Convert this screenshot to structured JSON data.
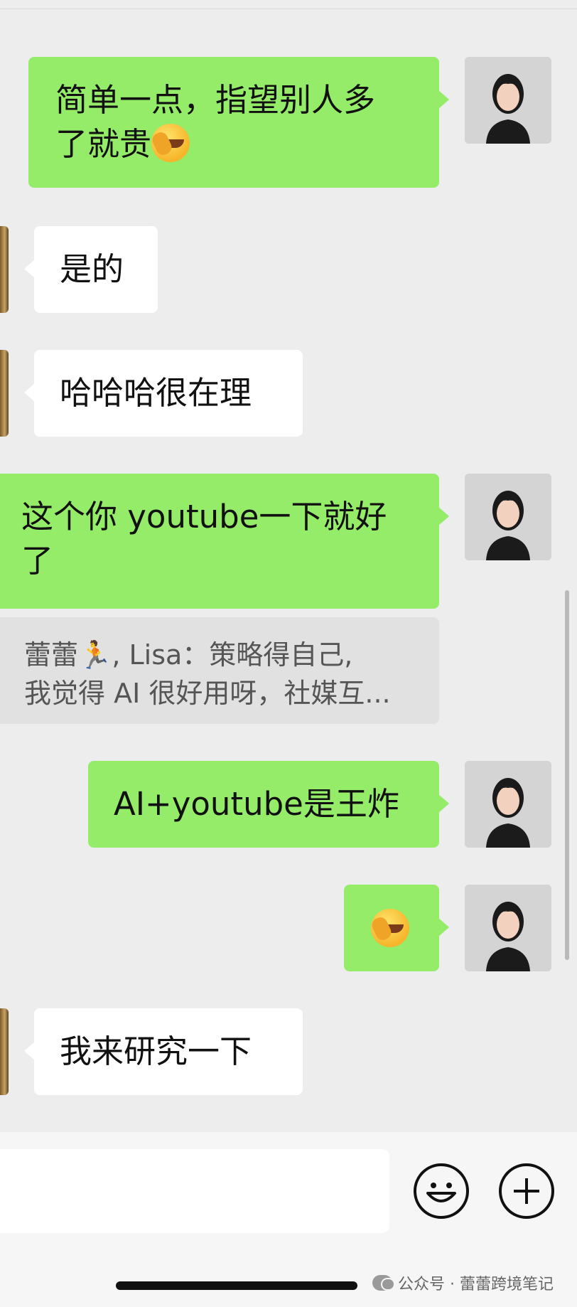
{
  "messages": [
    {
      "side": "me",
      "text": "简单一点，指望别人多了就贵",
      "line1": "简单一点，指望别人多",
      "line2": "了就贵",
      "emoji": "face-palm-emoji"
    },
    {
      "side": "them",
      "text": "是的"
    },
    {
      "side": "them",
      "text": "哈哈哈很在理"
    },
    {
      "side": "me",
      "line1": "这个你 youtube一下就好",
      "line2": "了"
    },
    {
      "side": "me",
      "text": "AI+youtube是王炸"
    },
    {
      "side": "me",
      "emoji": "face-palm-emoji"
    },
    {
      "side": "them",
      "text": "我来研究一下"
    }
  ],
  "quote": {
    "line1": "蕾蕾🏃, Lisa：策略得自己,",
    "line2": "我觉得 AI 很好用呀，社媒互..."
  },
  "input": {
    "placeholder": ""
  },
  "toolbar": {
    "emoji_icon": "smiley-icon",
    "more_icon": "plus-circle-icon"
  },
  "watermark": {
    "text": "公众号 · 蕾蕾跨境笔记"
  },
  "colors": {
    "background": "#ededed",
    "my_bubble": "#95ec69",
    "their_bubble": "#ffffff"
  }
}
